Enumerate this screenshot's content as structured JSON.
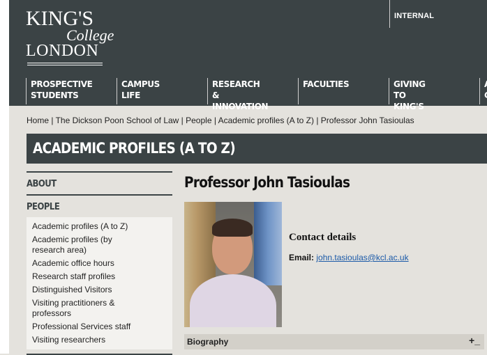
{
  "logo": {
    "line1": "KING'S",
    "line2": "College",
    "line3": "LONDON"
  },
  "header": {
    "internal_label": "INTERNAL"
  },
  "nav": [
    {
      "label": "PROSPECTIVE\nSTUDENTS"
    },
    {
      "label": "CAMPUS LIFE"
    },
    {
      "label": "RESEARCH &\nINNOVATION"
    },
    {
      "label": "FACULTIES"
    },
    {
      "label": "GIVING\nTO KING'S"
    },
    {
      "label": "A\nC"
    }
  ],
  "breadcrumb": "Home | The Dickson Poon School of Law | People | Academic profiles (A to Z) | Professor John Tasioulas",
  "page_title": "ACADEMIC PROFILES (A TO Z)",
  "sidebar": {
    "about": "ABOUT",
    "people": "PEOPLE",
    "items": [
      "Academic profiles (A to Z)",
      "Academic profiles (by research area)",
      "Academic office hours",
      "Research staff profiles",
      "Distinguished Visitors",
      "Visiting practitioners & professors",
      "Professional Services staff",
      "Visiting researchers"
    ]
  },
  "profile": {
    "name": "Professor John Tasioulas",
    "contact_title": "Contact details",
    "email_label": "Email:",
    "email": "john.tasioulas@kcl.ac.uk"
  },
  "biography": {
    "label": "Biography",
    "toggle": "+_"
  }
}
